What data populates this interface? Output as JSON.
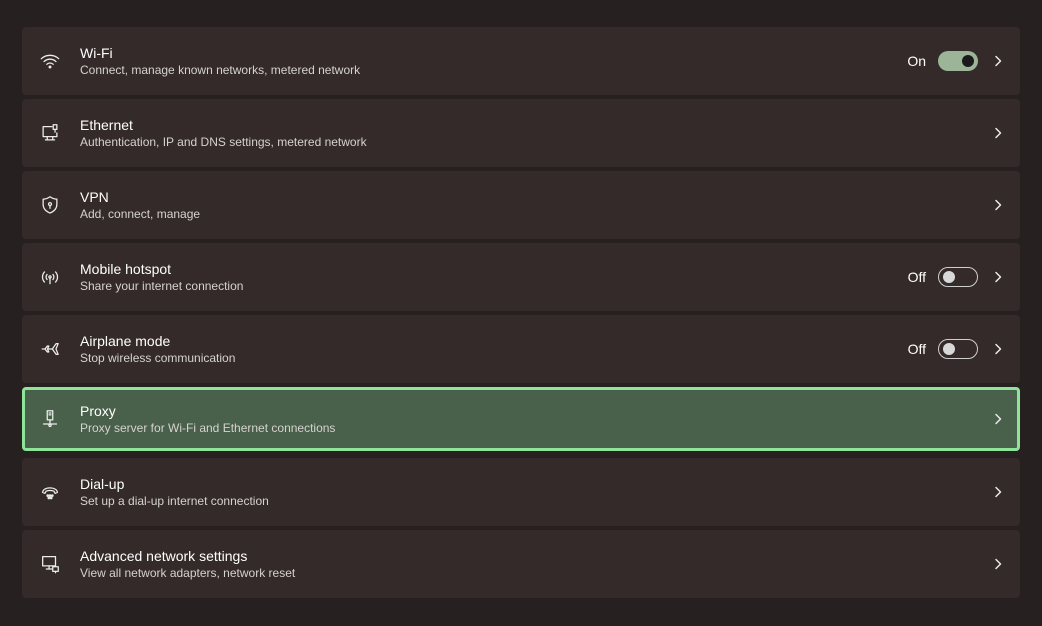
{
  "items": [
    {
      "title": "Wi-Fi",
      "subtitle": "Connect, manage known networks, metered network",
      "state": "On",
      "icon": "wifi-icon"
    },
    {
      "title": "Ethernet",
      "subtitle": "Authentication, IP and DNS settings, metered network",
      "icon": "ethernet-icon"
    },
    {
      "title": "VPN",
      "subtitle": "Add, connect, manage",
      "icon": "vpn-shield-icon"
    },
    {
      "title": "Mobile hotspot",
      "subtitle": "Share your internet connection",
      "state": "Off",
      "icon": "hotspot-icon"
    },
    {
      "title": "Airplane mode",
      "subtitle": "Stop wireless communication",
      "state": "Off",
      "icon": "airplane-icon"
    },
    {
      "title": "Proxy",
      "subtitle": "Proxy server for Wi-Fi and Ethernet connections",
      "icon": "proxy-icon",
      "selected": true
    },
    {
      "title": "Dial-up",
      "subtitle": "Set up a dial-up internet connection",
      "icon": "dialup-icon"
    },
    {
      "title": "Advanced network settings",
      "subtitle": "View all network adapters, network reset",
      "icon": "advanced-network-icon"
    }
  ],
  "colors": {
    "background": "#272020",
    "card": "#332a29",
    "selected_card": "#49604a",
    "selected_border": "#8ee59a",
    "toggle_on": "#9cb497"
  }
}
